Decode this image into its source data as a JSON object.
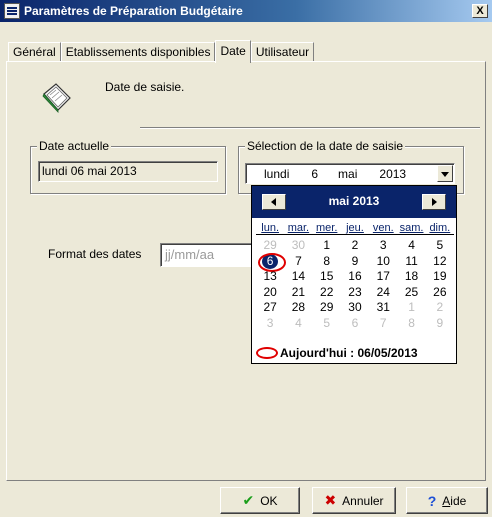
{
  "window": {
    "title": "Paramètres de Préparation Budgétaire",
    "close_label": "X"
  },
  "tabs": [
    {
      "label": "Général",
      "active": false
    },
    {
      "label": "Etablissements disponibles",
      "active": false
    },
    {
      "label": "Date",
      "active": true
    },
    {
      "label": "Utilisateur",
      "active": false
    }
  ],
  "section": {
    "title": "Date de saisie."
  },
  "current_date": {
    "group_label": "Date actuelle",
    "value": "lundi 06 mai 2013"
  },
  "date_selection": {
    "group_label": "Sélection de la date de saisie",
    "weekday": "lundi",
    "day": "6",
    "month": "mai",
    "year": "2013"
  },
  "format": {
    "label": "Format des dates",
    "placeholder": "jj/mm/aa"
  },
  "calendar": {
    "month_title": "mai 2013",
    "weekdays": [
      "lun.",
      "mar.",
      "mer.",
      "jeu.",
      "ven.",
      "sam.",
      "dim."
    ],
    "weeks": [
      [
        {
          "d": "29",
          "o": true
        },
        {
          "d": "30",
          "o": true
        },
        {
          "d": "1"
        },
        {
          "d": "2"
        },
        {
          "d": "3"
        },
        {
          "d": "4"
        },
        {
          "d": "5"
        }
      ],
      [
        {
          "d": "6",
          "s": true
        },
        {
          "d": "7"
        },
        {
          "d": "8"
        },
        {
          "d": "9"
        },
        {
          "d": "10"
        },
        {
          "d": "11"
        },
        {
          "d": "12"
        }
      ],
      [
        {
          "d": "13"
        },
        {
          "d": "14"
        },
        {
          "d": "15"
        },
        {
          "d": "16"
        },
        {
          "d": "17"
        },
        {
          "d": "18"
        },
        {
          "d": "19"
        }
      ],
      [
        {
          "d": "20"
        },
        {
          "d": "21"
        },
        {
          "d": "22"
        },
        {
          "d": "23"
        },
        {
          "d": "24"
        },
        {
          "d": "25"
        },
        {
          "d": "26"
        }
      ],
      [
        {
          "d": "27"
        },
        {
          "d": "28"
        },
        {
          "d": "29"
        },
        {
          "d": "30"
        },
        {
          "d": "31"
        },
        {
          "d": "1",
          "o": true
        },
        {
          "d": "2",
          "o": true
        }
      ],
      [
        {
          "d": "3",
          "o": true
        },
        {
          "d": "4",
          "o": true
        },
        {
          "d": "5",
          "o": true
        },
        {
          "d": "6",
          "o": true
        },
        {
          "d": "7",
          "o": true
        },
        {
          "d": "8",
          "o": true
        },
        {
          "d": "9",
          "o": true
        }
      ]
    ],
    "today_label": "Aujourd'hui : 06/05/2013"
  },
  "buttons": {
    "ok": "OK",
    "cancel": "Annuler",
    "help": "Aide"
  },
  "icons": {
    "app": "settings-window-icon",
    "section": "book-icon",
    "ok": "check-icon",
    "cancel": "x-icon",
    "help": "question-mark-icon"
  }
}
